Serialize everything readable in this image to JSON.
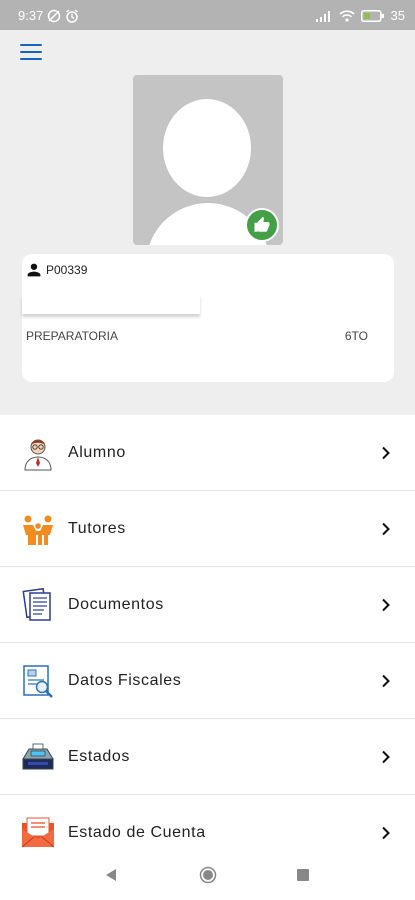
{
  "status_bar": {
    "time": "9:37",
    "battery": "35"
  },
  "profile": {
    "student_id": "P00339",
    "level": "PREPARATORIA",
    "grade": "6TO"
  },
  "menu": [
    {
      "label": "Alumno",
      "icon": "student-icon"
    },
    {
      "label": "Tutores",
      "icon": "family-icon"
    },
    {
      "label": "Documentos",
      "icon": "documents-icon"
    },
    {
      "label": "Datos Fiscales",
      "icon": "fiscal-data-icon"
    },
    {
      "label": "Estados",
      "icon": "cash-register-icon"
    },
    {
      "label": "Estado de Cuenta",
      "icon": "account-statement-icon"
    }
  ],
  "colors": {
    "accent": "#1565c0",
    "like_badge": "#43a047",
    "background": "#eeeeee"
  }
}
